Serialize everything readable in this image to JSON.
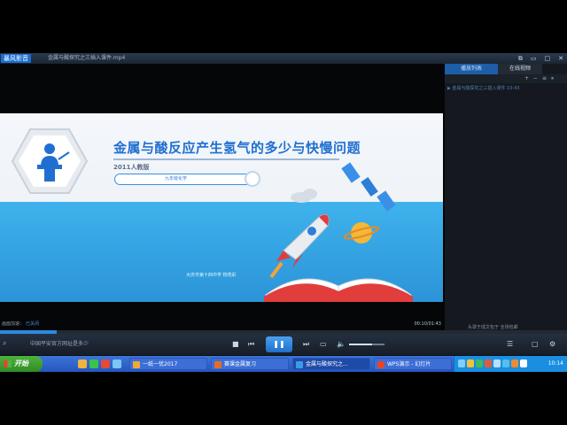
{
  "player": {
    "app_name": "暴风影音",
    "video_title": "金属与酸探究之三插入课件.mp4",
    "controls": {
      "minimize": "▭",
      "maximize": "□",
      "close": "✕",
      "restore": "⧉"
    }
  },
  "slide": {
    "title": "金属与酸反应产生氢气的多少与快慢问题",
    "subtitle": "2011人教版",
    "grade": "九年级化学",
    "school": "大庆市第十四中学  杨亮彩"
  },
  "playlist": {
    "tabs": [
      "播放列表",
      "在线视频"
    ],
    "tool_icons": [
      "+",
      "−",
      "≡",
      "⏸"
    ],
    "items": [
      {
        "label": "▶ 金属与酸探究之三插入课件   10:43"
      }
    ],
    "footer": "头罩于成文包于  全场包邮"
  },
  "status": {
    "accel_label": "画面加速：",
    "accel_link": "已关闭",
    "time": "00:10/01:43",
    "progress": 0.1
  },
  "controlbar": {
    "search_icon": "⌕",
    "ad_text": "中国平安官方网址是多少",
    "buttons": {
      "stop": "■",
      "prev": "⏮",
      "play_pause": "❚❚",
      "next": "⏭",
      "open": "▭",
      "volume": "🔈"
    },
    "volume": 0.65,
    "right_buttons": [
      "☰",
      "▢",
      "⚙"
    ]
  },
  "taskbar": {
    "start_label": "开始",
    "tasks": [
      {
        "label": "一纸一忧2017",
        "active": false
      },
      {
        "label": "赛课金属复习",
        "active": false
      },
      {
        "label": "金属与酸探究之...",
        "active": true
      },
      {
        "label": "WPS演示 - 幻灯片",
        "active": false
      }
    ],
    "clock": "10:14"
  },
  "colors": {
    "accent": "#1f6fd1",
    "band": "#3fb2ec",
    "taskbar": "#2457c0"
  }
}
